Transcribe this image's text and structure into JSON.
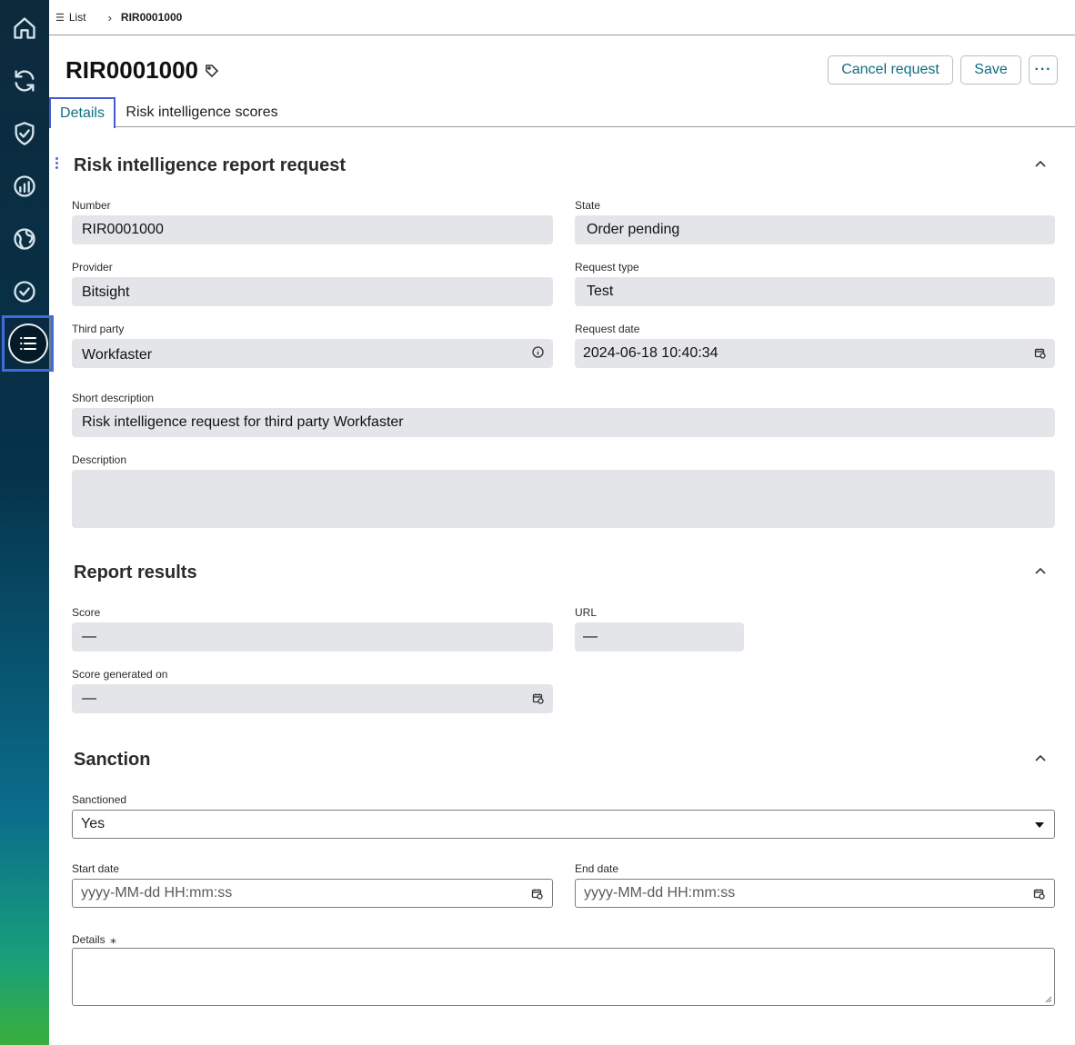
{
  "breadcrumb": {
    "list_label": "List",
    "current": "RIR0001000"
  },
  "header": {
    "title": "RIR0001000",
    "cancel_label": "Cancel request",
    "save_label": "Save",
    "more_label": "···"
  },
  "tabs": [
    {
      "label": "Details",
      "active": true
    },
    {
      "label": "Risk intelligence scores",
      "active": false
    }
  ],
  "sections": {
    "request": {
      "title": "Risk intelligence report request",
      "number_label": "Number",
      "number_value": "RIR0001000",
      "state_label": "State",
      "state_value": "Order pending",
      "provider_label": "Provider",
      "provider_value": "Bitsight",
      "request_type_label": "Request type",
      "request_type_value": "Test",
      "third_party_label": "Third party",
      "third_party_value": "Workfaster",
      "request_date_label": "Request date",
      "request_date_value": "2024-06-18 10:40:34",
      "short_desc_label": "Short description",
      "short_desc_value": "Risk intelligence request for third party Workfaster",
      "description_label": "Description",
      "description_value": ""
    },
    "results": {
      "title": "Report results",
      "score_label": "Score",
      "score_value": "—",
      "url_label": "URL",
      "url_value": "—",
      "score_generated_label": "Score generated on",
      "score_generated_value": "—"
    },
    "sanction": {
      "title": "Sanction",
      "sanctioned_label": "Sanctioned",
      "sanctioned_value": "Yes",
      "start_date_label": "Start date",
      "start_date_placeholder": "yyyy-MM-dd HH:mm:ss",
      "end_date_label": "End date",
      "end_date_placeholder": "yyyy-MM-dd HH:mm:ss",
      "details_label": "Details",
      "details_required_mark": "⁎"
    }
  },
  "icons": {
    "sidebar": [
      "home-icon",
      "refresh-icon",
      "shield-check-icon",
      "dashboard-gauge-icon",
      "globe-icon",
      "check-circle-icon",
      "list-icon"
    ],
    "accent_color": "#0c6f86",
    "active_outline_color": "#4169e1"
  }
}
